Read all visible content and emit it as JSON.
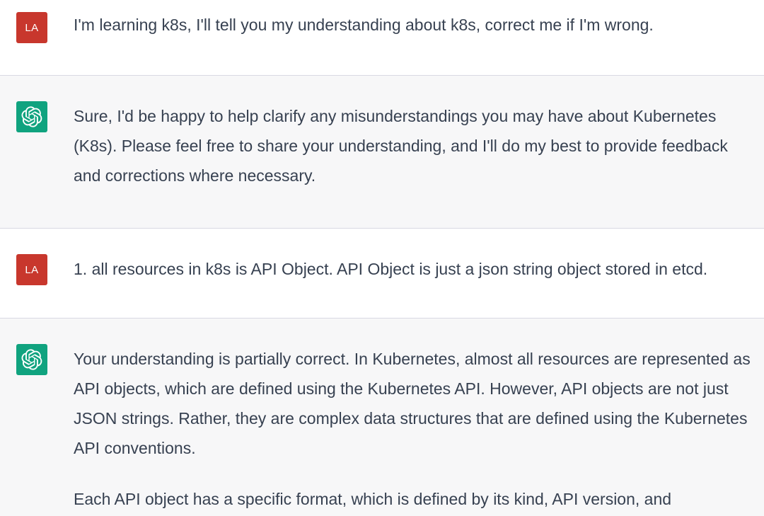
{
  "conversation": {
    "messages": [
      {
        "role": "user",
        "avatar_initials": "LA",
        "paragraphs": [
          "I'm learning k8s, I'll tell you my understanding about k8s, correct me if I'm wrong."
        ]
      },
      {
        "role": "assistant",
        "avatar_icon": "openai-logo-icon",
        "paragraphs": [
          "Sure, I'd be happy to help clarify any misunderstandings you may have about Kubernetes (K8s). Please feel free to share your understanding, and I'll do my best to provide feedback and corrections where necessary."
        ]
      },
      {
        "role": "user",
        "avatar_initials": "LA",
        "paragraphs": [
          "1. all resources in k8s is API Object. API Object is just a json string object stored in etcd."
        ]
      },
      {
        "role": "assistant",
        "avatar_icon": "openai-logo-icon",
        "paragraphs": [
          "Your understanding is partially correct. In Kubernetes, almost all resources are represented as API objects, which are defined using the Kubernetes API. However, API objects are not just JSON strings. Rather, they are complex data structures that are defined using the Kubernetes API conventions.",
          "Each API object has a specific format, which is defined by its kind, API version, and"
        ]
      }
    ]
  },
  "colors": {
    "user_avatar_bg": "#c8372d",
    "assistant_avatar_bg": "#10a37f",
    "assistant_row_bg": "#f7f7f8",
    "user_row_bg": "#ffffff",
    "text": "#374151"
  }
}
